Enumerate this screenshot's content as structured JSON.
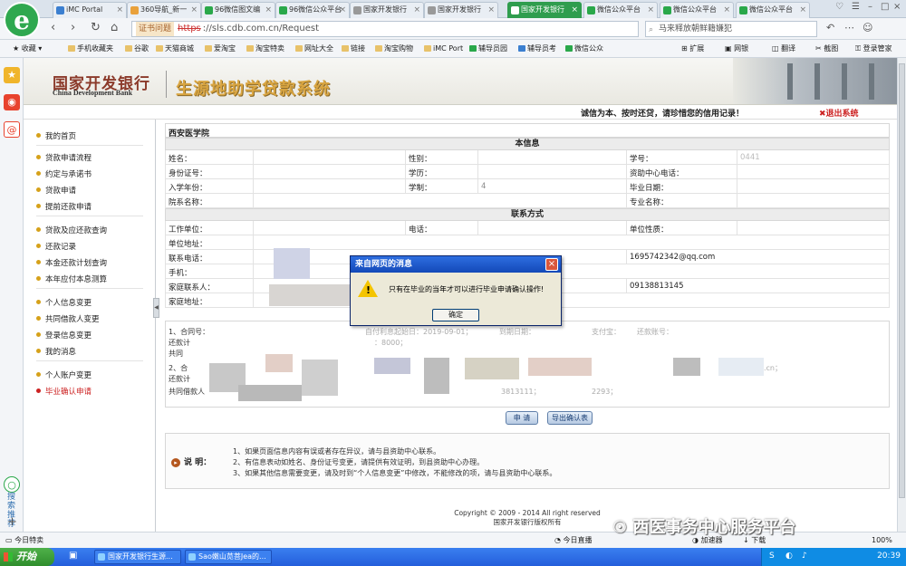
{
  "browser": {
    "tabs": [
      {
        "label": "iMC Portal"
      },
      {
        "label": "360导航_新一"
      },
      {
        "label": "96微信图文编"
      },
      {
        "label": "96微信公众平台"
      },
      {
        "label": "国家开发银行"
      },
      {
        "label": "国家开发银行"
      },
      {
        "label": "国家开发银行"
      },
      {
        "label": "微信公众平台"
      },
      {
        "label": "微信公众平台"
      },
      {
        "label": "微信公众平台"
      }
    ],
    "address": {
      "cert": "证书问题",
      "scheme": "https",
      "url": "://sls.cdb.com.cn/Request"
    },
    "search": {
      "value": "马来释放朝鲜籍嫌犯"
    },
    "bookmarks": [
      "收藏",
      "手机收藏夹",
      "谷歌",
      "天猫商城",
      "爱淘宝",
      "淘宝特卖",
      "网址大全",
      "链接",
      "淘宝购物",
      "iMC Port",
      "辅导员园",
      "辅导员考",
      "微信公众"
    ],
    "toolbar_right": [
      "扩展",
      "网银",
      "翻译",
      "截图",
      "登录管家"
    ]
  },
  "header": {
    "bank_cn": "国家开发银行",
    "bank_en": "China Development Bank",
    "system_title": "生源地助学贷款系统",
    "slogan": "诚信为本、按时还贷，请珍惜您的信用记录！",
    "logout": "退出系统"
  },
  "nav": [
    {
      "label": "我的首页"
    },
    {
      "label": "贷款申请流程"
    },
    {
      "label": "约定与承诺书"
    },
    {
      "label": "贷款申请"
    },
    {
      "label": "提前还款申请"
    },
    {
      "label": "贷款及应还款查询"
    },
    {
      "label": "还款记录"
    },
    {
      "label": "本金还款计划查询"
    },
    {
      "label": "本年应付本息测算"
    },
    {
      "label": "个人信息变更"
    },
    {
      "label": "共同借款人变更"
    },
    {
      "label": "登录信息变更"
    },
    {
      "label": "我的消息"
    },
    {
      "label": "个人账户变更"
    },
    {
      "label": "毕业确认申请"
    }
  ],
  "main": {
    "school": "西安医学院",
    "basic_section": "本信息",
    "basic_rows": [
      [
        {
          "label": "姓名："
        },
        {
          "label": "性别："
        },
        {
          "label": "学号：",
          "value": "0441"
        }
      ],
      [
        {
          "label": "身份证号："
        },
        {
          "label": "学历："
        },
        {
          "label": "资助中心电话："
        }
      ],
      [
        {
          "label": "入学年份："
        },
        {
          "label": "学制：",
          "value": "4"
        },
        {
          "label": "毕业日期："
        }
      ],
      [
        {
          "label": "院系名称："
        },
        {
          "label": ""
        },
        {
          "label": "专业名称："
        }
      ]
    ],
    "contact_section": "联系方式",
    "contact_rows": [
      [
        {
          "label": "工作单位："
        },
        {
          "label": "电话："
        },
        {
          "label": "单位性质："
        }
      ],
      [
        {
          "label": "单位地址："
        },
        {
          "label": ""
        },
        {
          "label": ""
        }
      ],
      [
        {
          "label": "联系电话："
        },
        {
          "label": ""
        },
        {
          "label": "",
          "value": "1695742342@qq.com"
        }
      ],
      [
        {
          "label": "手机："
        },
        {
          "label": ""
        },
        {
          "label": ""
        }
      ],
      [
        {
          "label": "家庭联系人："
        },
        {
          "label": ""
        },
        {
          "label": "",
          "value": "09138813145"
        }
      ],
      [
        {
          "label": "家庭地址："
        },
        {
          "label": ""
        },
        {
          "label": ""
        }
      ]
    ],
    "contracts": {
      "line1": "1、合同号：",
      "line1_mid": "自付利息起始日：2019-09-01；",
      "line1_end": "到期日期：",
      "line1_right": "还款账号：",
      "line1_right2": "支付宝：",
      "line2": "还款计",
      "line2_mid": "：8000；",
      "line3": "共同",
      "line4": "2、合",
      "line4_right": "qa.cn；",
      "line5": "还款计",
      "line6": "共同借款人",
      "line6_mid": "3813111；",
      "line6_mid2": "2293；"
    },
    "buttons": {
      "apply": "申 请",
      "export": "导出确认表"
    },
    "notes_title": "说 明：",
    "notes": [
      "1、如果页面信息内容有误或者存在异议，请与县资助中心联系。",
      "2、有信息表动如姓名、身份证号变更，请提供有效证明，到县资助中心办理。",
      "3、如果其他信息需要变更，请及时到“个人信息变更”中修改，不能修改的项，请与县资助中心联系。"
    ],
    "footer_copy": "Copyright © 2009 - 2014 All right reserved",
    "footer_owner": "国家开发银行版权所有"
  },
  "dialog": {
    "title": "来自网页的消息",
    "message": "只有在毕业的当年才可以进行毕业申请确认操作!",
    "ok": "确定"
  },
  "side_panel": {
    "search_recommend": "搜索推荐"
  },
  "statusbar": {
    "left": "今日特卖",
    "items": [
      "今日直播",
      "加速器",
      "下载",
      "100%"
    ]
  },
  "taskbar": {
    "start": "开始",
    "tasks": [
      "国家开发银行生源...",
      "Sao嫩山苋菩Jea的..."
    ],
    "clock": "20:39"
  },
  "watermark": "西医事务中心服务平台"
}
